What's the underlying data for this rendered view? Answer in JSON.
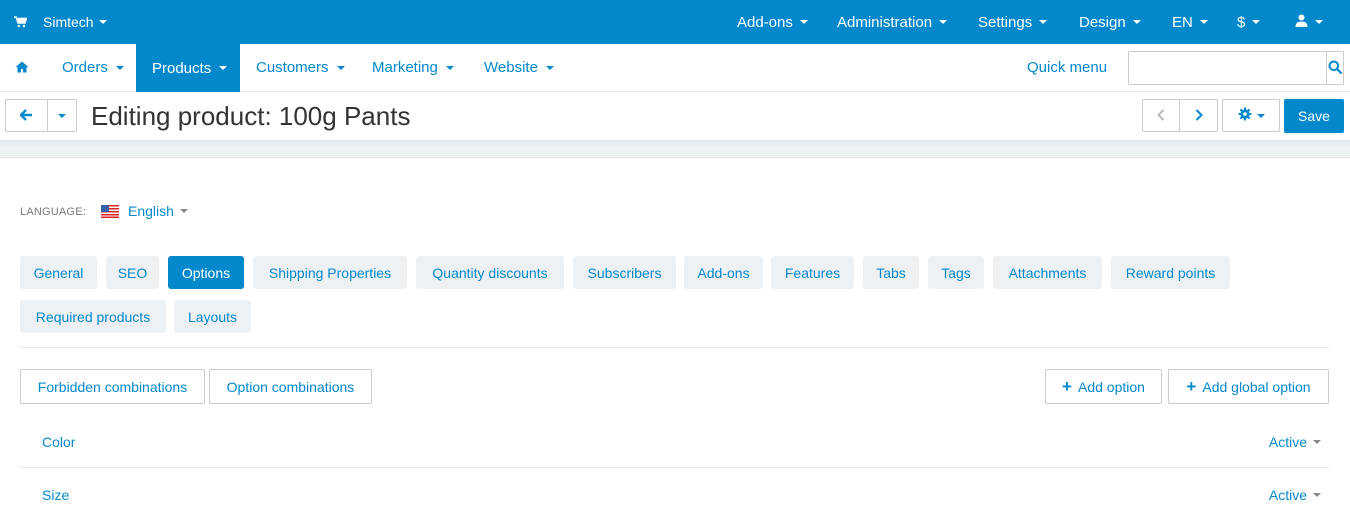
{
  "topbar": {
    "store": "Simtech",
    "menus": [
      "Add-ons",
      "Administration",
      "Settings",
      "Design",
      "EN",
      "$"
    ]
  },
  "nav": {
    "items": [
      "Orders",
      "Products",
      "Customers",
      "Marketing",
      "Website"
    ],
    "active": "Products",
    "quick_menu": "Quick menu",
    "search_value": ""
  },
  "title": {
    "text": "Editing product: 100g Pants",
    "save": "Save"
  },
  "language": {
    "label": "LANGUAGE:",
    "value": "English"
  },
  "tabs": [
    "General",
    "SEO",
    "Options",
    "Shipping Properties",
    "Quantity discounts",
    "Subscribers",
    "Add-ons",
    "Features",
    "Tabs",
    "Tags",
    "Attachments",
    "Reward points",
    "Required products",
    "Layouts"
  ],
  "active_tab": "Options",
  "actions": {
    "forbidden": "Forbidden combinations",
    "combinations": "Option combinations",
    "add_option": "Add option",
    "add_global": "Add global option"
  },
  "options": [
    {
      "name": "Color",
      "status": "Active"
    },
    {
      "name": "Size",
      "status": "Active"
    }
  ],
  "colors": {
    "primary": "#0388cc",
    "tab_bg": "#eef1f3"
  }
}
